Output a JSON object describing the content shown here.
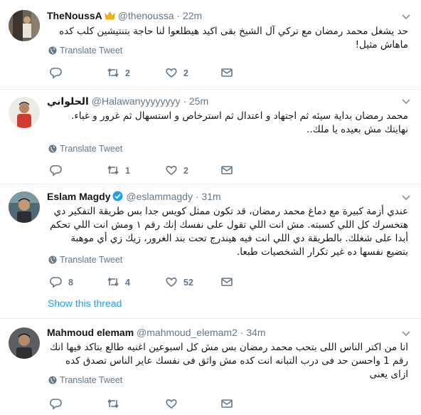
{
  "tweets": [
    {
      "name": "TheNoussA",
      "handle": "@thenoussa",
      "dot": "·",
      "time": "22m",
      "text": "حد يشغل محمد رمضان مع تركي آل الشيخ بقى اكيد هيطلعوا لنا حاجة بتنتيشين كلب كده ماهاش مثيل!",
      "translate": "Translate Tweet",
      "reply_count": "",
      "retweet_count": "2",
      "like_count": "2"
    },
    {
      "name": "الحلواني",
      "handle": "@Halawanyyyyyyyy",
      "dot": "·",
      "time": "25m",
      "text": "محمد رمضان بداية سيئه ثم اجتهاد و اعتدال ثم استرخاص و استسهال ثم غرور و غباء. نهايتك مش بعيده يا ملك..",
      "translate": "Translate Tweet",
      "reply_count": "",
      "retweet_count": "1",
      "like_count": "2"
    },
    {
      "name": "Eslam Magdy",
      "handle": "@eslammagdy",
      "dot": "·",
      "time": "31m",
      "text": "عندي أزمة كبيرة مع دماغ محمد رمضان، قد تكون ممثل كويس جدا بس طريقة التفكير دي هتخسرك كل اللي كسبته. مش انت اللي تقول على نفسك إنك رقم ١ ومش انت اللي تحكم أبدا على شغلك. بالطريقة دي اللي انت فيه هيندرج تحت بند الغرور، زيك زي أي موهبة بتضيع نفسها ده غير تكرار الشخصيات طبعا.",
      "translate": "Translate Tweet",
      "reply_count": "8",
      "retweet_count": "4",
      "like_count": "52",
      "show_thread": "Show this thread"
    },
    {
      "name": "Mahmoud elemam",
      "handle": "@mahmoud_elemam2",
      "dot": "·",
      "time": "34m",
      "text": "انا من اكتر الناس اللى بتحب محمد رمضان بس مش كل اسبوعين اغنيه طالع بتاكد فيها انك رقم 1 واحسن حد فى درب التبانه انت كده مش واثق فى نفسك عاير الناس تصدق كده ازاى يعنى",
      "translate": "Translate Tweet"
    }
  ],
  "colors": {
    "text": "#14171a",
    "secondary": "#657786",
    "link": "#1da1f2",
    "divider": "#e6ecf0"
  },
  "icons": {
    "reply": "reply-icon",
    "retweet": "retweet-icon",
    "like": "heart-icon",
    "dm": "envelope-icon",
    "globe": "globe-icon",
    "chevron": "chevron-down-icon",
    "verified": "verified-badge-icon",
    "crown": "crown-emoji-icon"
  }
}
